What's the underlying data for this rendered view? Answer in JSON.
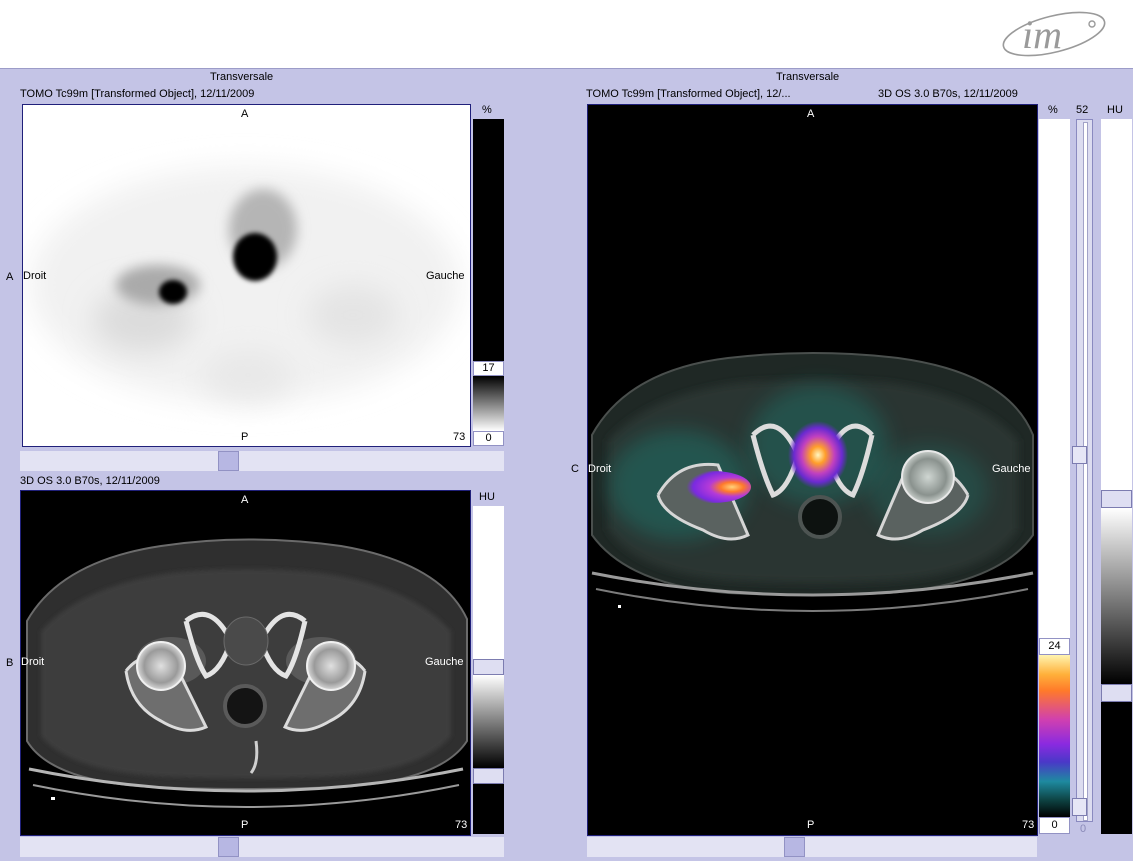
{
  "header": {
    "logo_text": "im"
  },
  "panels": {
    "spect": {
      "orientation": "Transversale",
      "caption": "TOMO Tc99m [Transformed Object], 12/11/2009",
      "row_label": "A",
      "top": "A",
      "bottom": "P",
      "left": "Droit",
      "right": "Gauche",
      "slice": "73",
      "scale_unit": "%",
      "scale_max": "17",
      "scale_min": "0"
    },
    "ct": {
      "caption": "3D OS  3.0  B70s, 12/11/2009",
      "row_label": "B",
      "top": "A",
      "bottom": "P",
      "left": "Droit",
      "right": "Gauche",
      "slice": "73",
      "scale_unit": "HU"
    },
    "fusion": {
      "orientation": "Transversale",
      "caption_left": "TOMO Tc99m [Transformed Object], 12/...",
      "caption_right": "3D OS  3.0  B70s, 12/11/2009",
      "row_label": "C",
      "top": "A",
      "bottom": "P",
      "left": "Droit",
      "right": "Gauche",
      "slice": "73",
      "pct_unit": "%",
      "pct_max": "24",
      "pct_min": "0",
      "blend_max": "52",
      "blend_min": "0",
      "hu_unit": "HU"
    }
  }
}
